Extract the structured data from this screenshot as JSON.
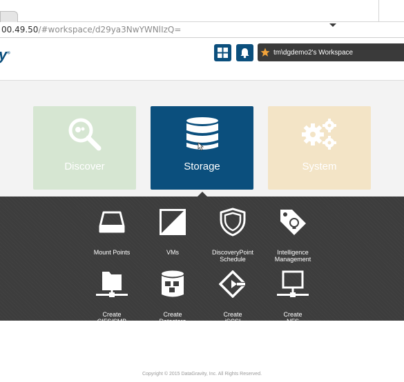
{
  "browser": {
    "url_main": "00.49.50",
    "url_rest": "/#workspace/d29ya3NwYWNlIzQ="
  },
  "header": {
    "brand_partial": "y",
    "apps_icon": "grid-icon",
    "notifications_icon": "bell-icon",
    "workspace_icon": "star-icon",
    "workspace_label": "tm\\dgdemo2's Workspace"
  },
  "tiles": [
    {
      "label": "Discover",
      "icon": "search-icon",
      "color": "#d6e6d2"
    },
    {
      "label": "Storage",
      "icon": "database-icon",
      "color": "#0b4f7d",
      "selected": true
    },
    {
      "label": "System",
      "icon": "gears-icon",
      "color": "#f3e4c6"
    }
  ],
  "submenu": [
    {
      "label": "Mount Points",
      "icon": "drive-icon"
    },
    {
      "label": "VMs",
      "icon": "vm-icon"
    },
    {
      "label": "DiscoveryPoint\nSchedule",
      "icon": "shield-icon"
    },
    {
      "label": "Intelligence\nManagement",
      "icon": "tag-bulb-icon"
    },
    {
      "label": "Create\nCIFS/SMB",
      "icon": "folder-network-icon"
    },
    {
      "label": "Create\nDatastore",
      "icon": "datastore-icon"
    },
    {
      "label": "Create\niSCSI",
      "icon": "iscsi-icon"
    },
    {
      "label": "Create\nNFS",
      "icon": "monitor-network-icon"
    }
  ],
  "footer": {
    "copyright": "Copyright © 2015 DataGravity, Inc. All Rights Reserved."
  }
}
